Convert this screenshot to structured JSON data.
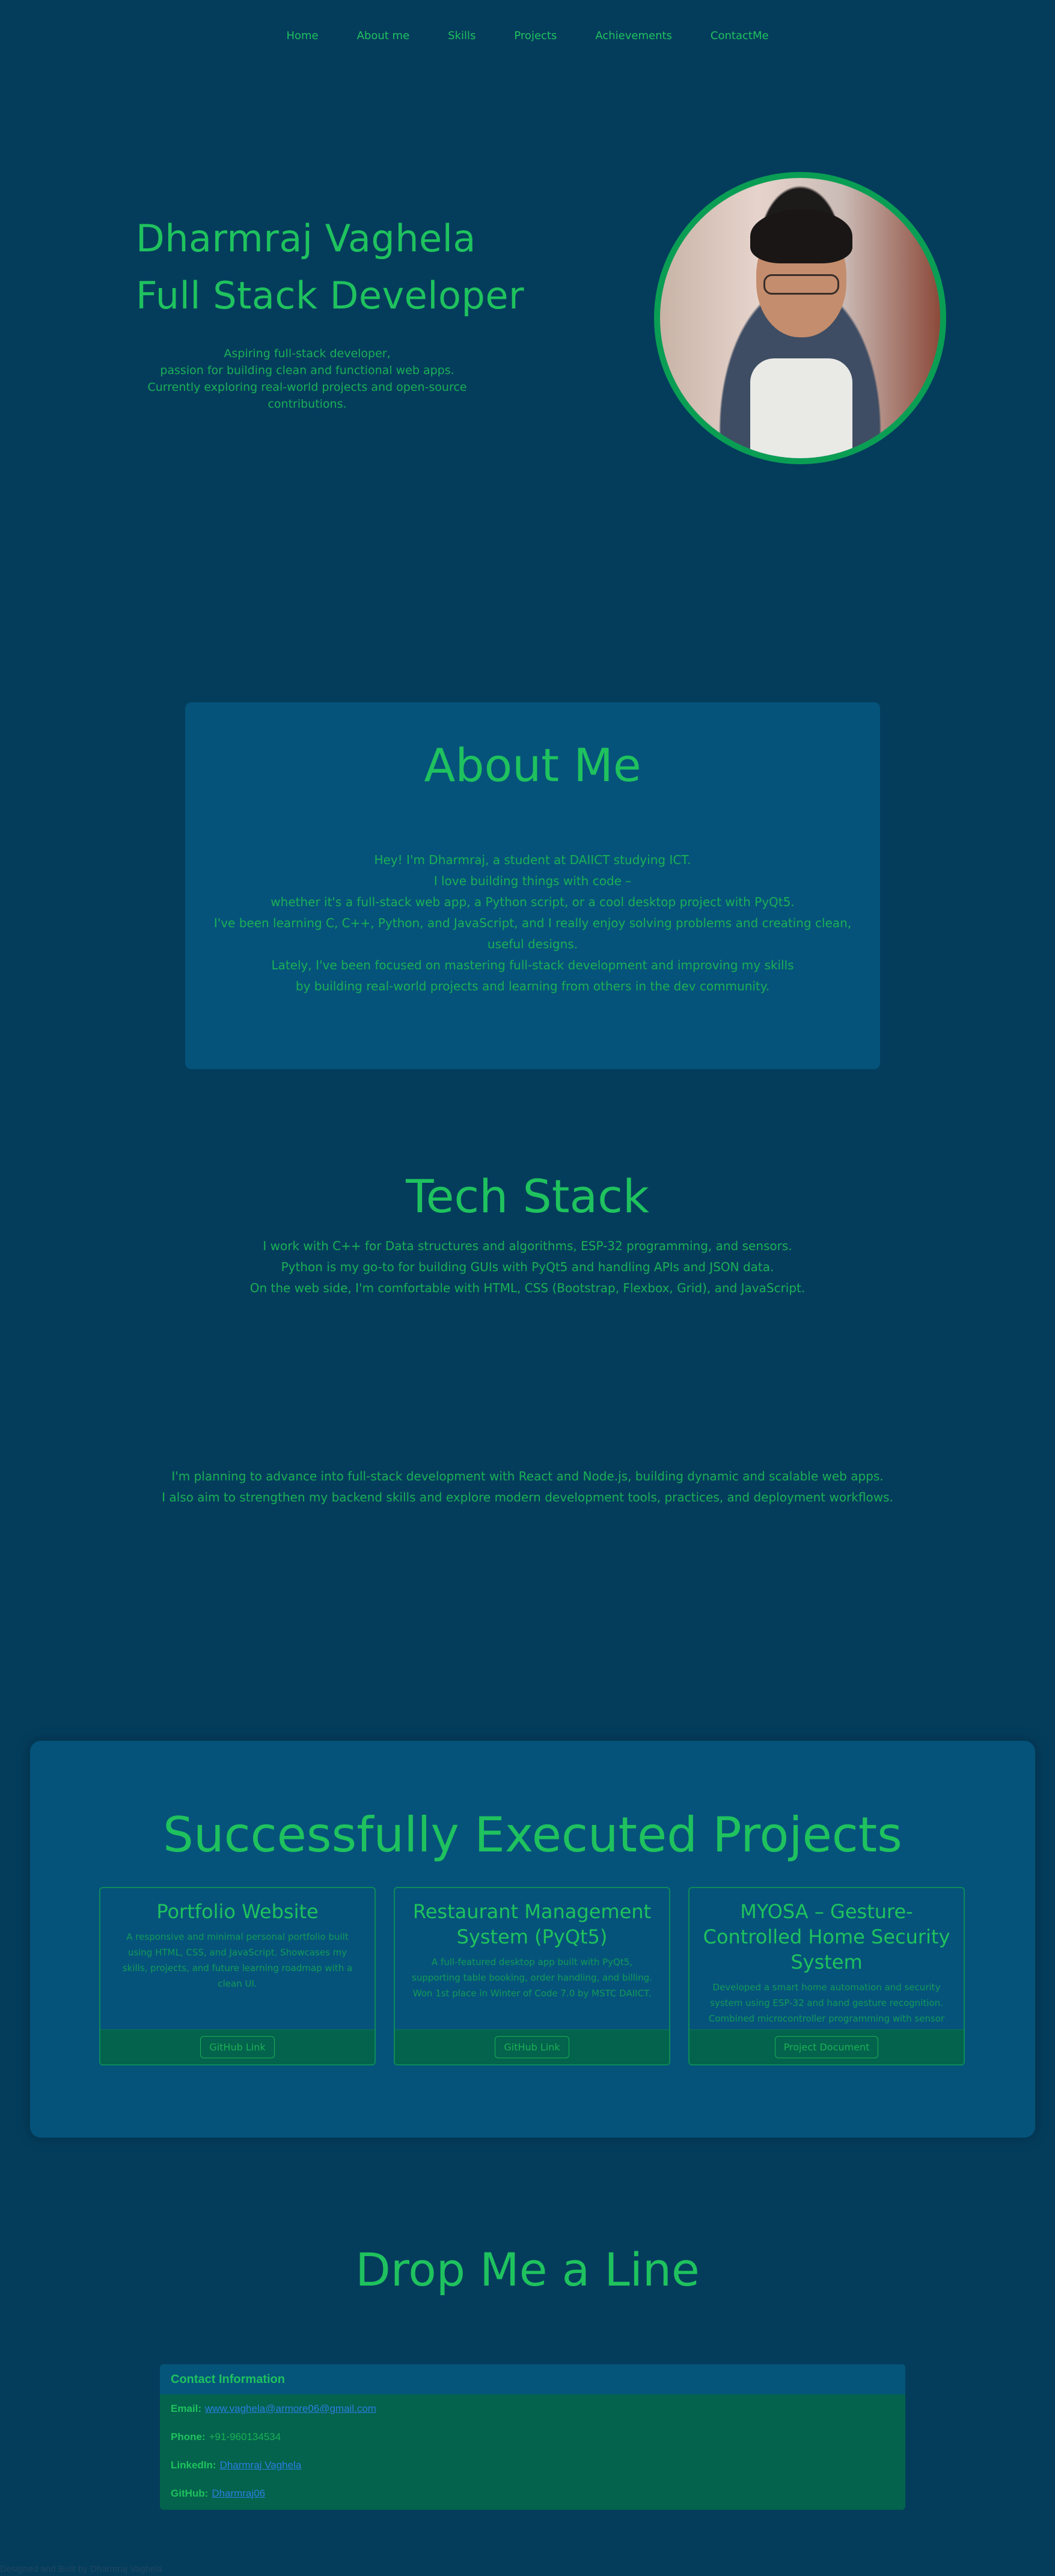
{
  "nav": {
    "items": [
      "Home",
      "About me",
      "Skills",
      "Projects",
      "Achievements",
      "ContactMe"
    ]
  },
  "hero": {
    "name": "Dharmraj Vaghela",
    "role": "Full Stack Developer",
    "desc_lines": [
      "Aspiring full-stack developer,",
      "passion for building clean and functional web apps.",
      "Currently exploring real-world projects and open-source",
      "contributions."
    ]
  },
  "about": {
    "title": "About Me",
    "lines": [
      "Hey! I'm Dharmraj, a student at DAIICT studying ICT.",
      "I love building things with code –",
      "whether it's a full-stack web app, a Python script, or a cool desktop project with PyQt5.",
      "I've been learning C, C++, Python, and JavaScript, and I really enjoy solving problems and creating clean,",
      "useful designs.",
      "Lately, I've been focused on mastering full-stack development and improving my skills",
      "by building real-world projects and learning from others in the dev community."
    ]
  },
  "tech": {
    "title": "Tech Stack",
    "lines": [
      "I work with C++ for Data structures and algorithms, ESP-32 programming, and sensors.",
      "Python is my go-to for building GUIs with PyQt5 and handling APIs and JSON data.",
      "On the web side, I'm comfortable with HTML, CSS (Bootstrap, Flexbox, Grid), and JavaScript."
    ],
    "plan_lines": [
      "I'm planning to advance into full-stack development with React and Node.js, building dynamic and scalable web apps.",
      "I also aim to strengthen my backend skills and explore modern development tools, practices, and deployment workflows."
    ]
  },
  "projects": {
    "title": "Successfully Executed Projects",
    "items": [
      {
        "title": "Portfolio Website",
        "desc": "A responsive and minimal personal portfolio built using HTML, CSS, and JavaScript. Showcases my skills, projects, and future learning roadmap with a clean UI.",
        "button": "GitHub Link"
      },
      {
        "title": "Restaurant Management System (PyQt5)",
        "desc": "A full-featured desktop app built with PyQt5, supporting table booking, order handling, and billing. Won 1st place in Winter of Code 7.0 by MSTC DAIICT.",
        "button": "GitHub Link"
      },
      {
        "title": "MYOSA – Gesture-Controlled Home Security System",
        "desc": "Developed a smart home automation and security system using ESP-32 and hand gesture recognition. Combined microcontroller programming with sensor integration for real-time control.",
        "button": "Project Document"
      }
    ]
  },
  "contact": {
    "title": "Drop Me a Line",
    "header": "Contact Information",
    "rows": [
      {
        "key": "Email:",
        "value": "www.vaghela@armore06@gmail.com",
        "link": true
      },
      {
        "key": "Phone:",
        "value": "+91-960134534",
        "link": false
      },
      {
        "key": "LinkedIn:",
        "value": "Dharmraj Vaghela",
        "link": true
      },
      {
        "key": "GitHub:",
        "value": "Dharmraj06",
        "link": true
      }
    ]
  },
  "footer": {
    "text": "Designed and Built by Dharmraj Vaghela"
  },
  "colors": {
    "background": "#043d5c",
    "card": "#05537a",
    "accent": "#1fc25e",
    "footer_band": "#03634c",
    "link": "#2b7de0"
  }
}
